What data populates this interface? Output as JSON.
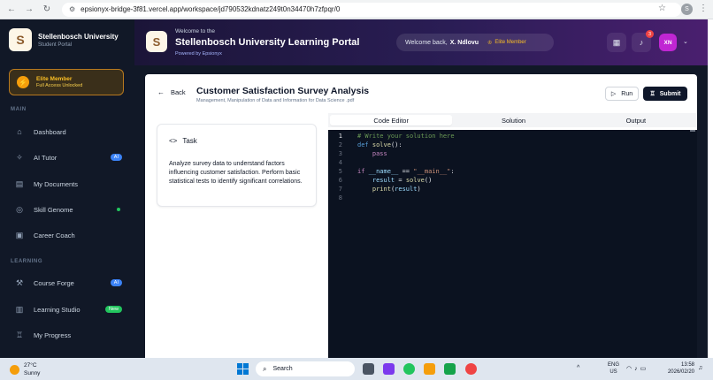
{
  "browser": {
    "url": "epsionyx-bridge-3f81.vercel.app/workspace/jd790532kdnatz249t0n34470h7zfpqr/0",
    "profile_initial": "S"
  },
  "sidebar": {
    "brand_title": "Stellenbosch University",
    "brand_sub": "Student Portal",
    "elite_title": "Elite Member",
    "elite_sub": "Full Access Unlocked",
    "section_main": "MAIN",
    "section_learning": "LEARNING",
    "items": [
      {
        "label": "Dashboard",
        "icon": "home-icon"
      },
      {
        "label": "AI Tutor",
        "icon": "sparkle-icon",
        "badge": "AI"
      },
      {
        "label": "My Documents",
        "icon": "document-icon"
      },
      {
        "label": "Skill Genome",
        "icon": "dna-icon",
        "dot": true
      },
      {
        "label": "Career Coach",
        "icon": "briefcase-icon"
      },
      {
        "label": "Course Forge",
        "icon": "hammer-icon",
        "badge": "AI"
      },
      {
        "label": "Learning Studio",
        "icon": "book-icon",
        "badge": "New"
      },
      {
        "label": "My Progress",
        "icon": "trophy-icon"
      }
    ]
  },
  "header": {
    "welcome": "Welcome to the",
    "title": "Stellenbosch University Learning Portal",
    "powered": "Powered by Epsionyx",
    "welcome_back": "Welcome back,",
    "user_name": "X. Ndlovu",
    "elite_label": "Elite Member",
    "notification_count": "3",
    "avatar_initials": "XN"
  },
  "page": {
    "back_label": "Back",
    "title": "Customer Satisfaction Survey Analysis",
    "subtitle": "Management, Manipulation of Data and Information for Data Science .pdf",
    "run_label": "Run",
    "submit_label": "Submit"
  },
  "task": {
    "heading": "Task",
    "body": "Analyze survey data to understand factors influencing customer satisfaction. Perform basic statistical tests to identify significant correlations."
  },
  "tabs": [
    "Code Editor",
    "Solution",
    "Output"
  ],
  "editor": {
    "line_numbers": [
      "1",
      "2",
      "3",
      "4",
      "5",
      "6",
      "7",
      "8"
    ]
  },
  "taskbar": {
    "temp": "27°C",
    "weather": "Sunny",
    "search": "Search",
    "lang_line1": "ENG",
    "lang_line2": "US",
    "time": "13:58",
    "date": "2026/02/20"
  },
  "colors": {
    "sidebar_bg": "#111827",
    "header_gradient_end": "#4a1f6f",
    "elite_gold": "#fbbf24",
    "submit_bg": "#0f172a",
    "editor_bg": "#0b1220"
  }
}
